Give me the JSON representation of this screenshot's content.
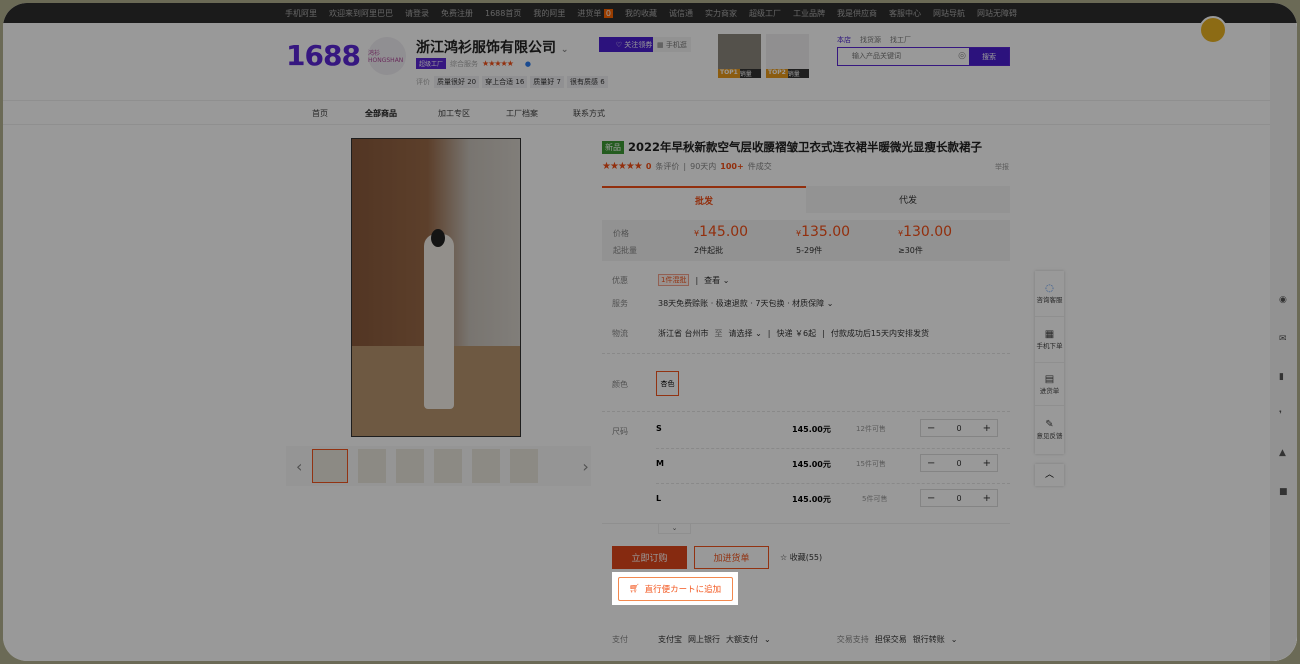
{
  "topbar": {
    "items": [
      "手机阿里",
      "欢迎来到阿里巴巴",
      "请登录",
      "免费注册",
      "1688首页",
      "我的阿里",
      "进货单",
      "0",
      "我的收藏",
      "诚信通",
      "实力商家",
      "超级工厂",
      "工业品牌",
      "我是供应商",
      "客服中心",
      "网站导航",
      "网站无障碍"
    ]
  },
  "header": {
    "logo": "1688",
    "store_logo": "鸿衫 HONGSHAN",
    "company": "浙江鸿衫服饰有限公司",
    "factory_badge": "超级工厂",
    "service_label": "综合服务",
    "stars": "★★★★★",
    "review_label": "评价",
    "review_tags": [
      "质量很好 20",
      "穿上合适 16",
      "质量好 7",
      "很有质感 6"
    ],
    "follow": "关注领券",
    "mobile": "手机逛",
    "hot": [
      {
        "rank": "TOP1",
        "label": "销量"
      },
      {
        "rank": "TOP2",
        "label": "销量"
      }
    ]
  },
  "search": {
    "tabs": [
      "本店",
      "找货源",
      "找工厂"
    ],
    "placeholder": "输入产品关键词",
    "button": "搜索"
  },
  "nav": [
    "首页",
    "全部商品",
    "加工专区",
    "工厂档案",
    "联系方式"
  ],
  "product": {
    "new_tag": "新品",
    "title": "2022年早秋新款空气层收腰褶皱卫衣式连衣裙半暖微光显瘦长款裙子",
    "stars": "★★★★★",
    "reviews_count": "0",
    "reviews_label": "条评价",
    "days": "90天内",
    "sold": "100+",
    "sold_label": "件成交",
    "report": "举报",
    "tabs": [
      "批发",
      "代发"
    ],
    "price_label": "价格",
    "moq_label": "起批量",
    "prices": [
      {
        "price": "145.00",
        "qty": "2件起批"
      },
      {
        "price": "135.00",
        "qty": "5-29件"
      },
      {
        "price": "130.00",
        "qty": "≥30件"
      }
    ],
    "currency": "¥",
    "promo_label": "优惠",
    "promo_tag": "1件混批",
    "promo_view": "查看",
    "service_label": "服务",
    "service": "38天免费赊账 · 极速退款 · 7天包换 · 材质保障",
    "logistics_label": "物流",
    "from": "浙江省 台州市",
    "to_label": "至",
    "to": "请选择",
    "express": "快递 ￥6起",
    "ship": "付款成功后15天内安排发货",
    "color_label": "颜色",
    "color": "杏色",
    "size_label": "尺码",
    "sizes": [
      {
        "size": "S",
        "price": "145.00元",
        "stock": "12件可售",
        "qty": "0"
      },
      {
        "size": "M",
        "price": "145.00元",
        "stock": "15件可售",
        "qty": "0"
      },
      {
        "size": "L",
        "price": "145.00元",
        "stock": "5件可售",
        "qty": "0"
      }
    ],
    "buy_now": "立即订购",
    "add_cart": "加进货单",
    "favorite": "收藏(55)",
    "direct_cart": "直行便カートに追加",
    "pay_label": "支付",
    "pay": [
      "支付宝",
      "网上银行",
      "大额支付"
    ],
    "trade_label": "交易支持",
    "trade": [
      "担保交易",
      "银行转账"
    ]
  },
  "floatbar": [
    "咨询客服",
    "手机下单",
    "进货单",
    "意见反馈"
  ]
}
